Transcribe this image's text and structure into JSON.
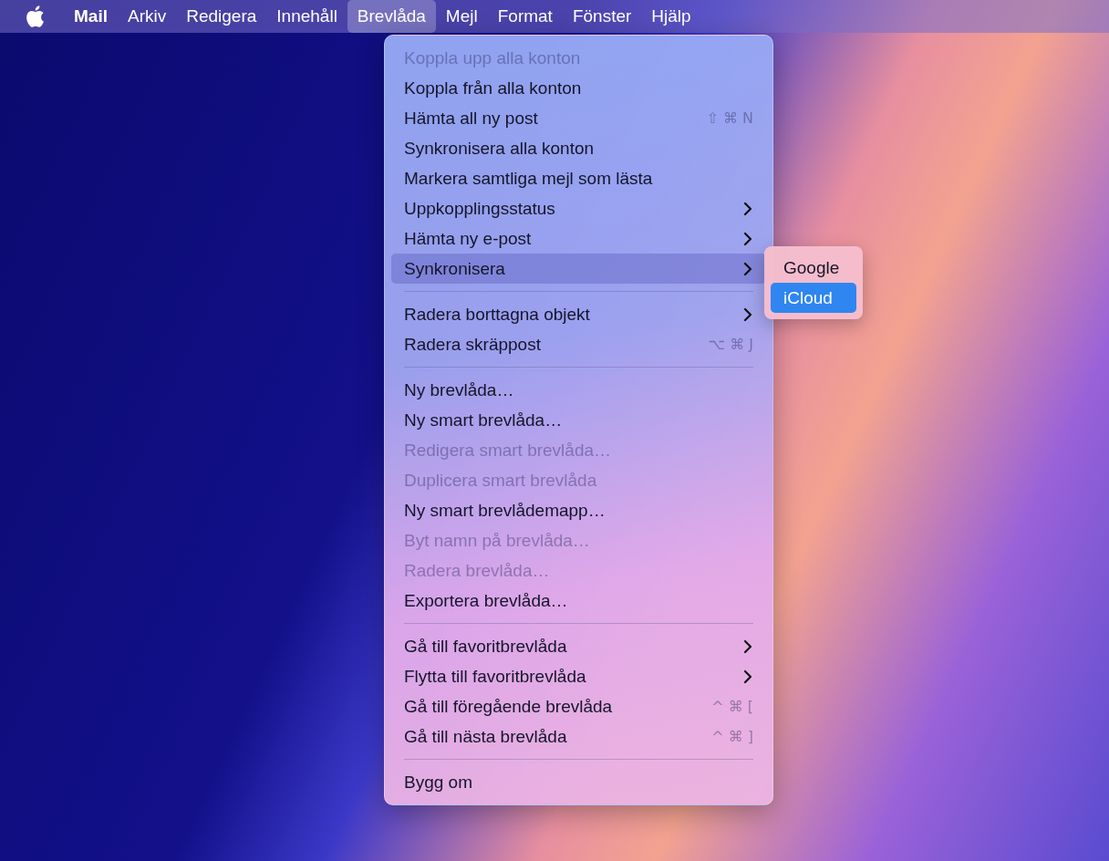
{
  "menu_bar": {
    "items": [
      {
        "label": "Mail",
        "kind": "app",
        "selected": false
      },
      {
        "label": "Arkiv",
        "kind": "menu",
        "selected": false
      },
      {
        "label": "Redigera",
        "kind": "menu",
        "selected": false
      },
      {
        "label": "Innehåll",
        "kind": "menu",
        "selected": false
      },
      {
        "label": "Brevlåda",
        "kind": "menu",
        "selected": true
      },
      {
        "label": "Mejl",
        "kind": "menu",
        "selected": false
      },
      {
        "label": "Format",
        "kind": "menu",
        "selected": false
      },
      {
        "label": "Fönster",
        "kind": "menu",
        "selected": false
      },
      {
        "label": "Hjälp",
        "kind": "menu",
        "selected": false
      }
    ]
  },
  "menu": {
    "items": [
      {
        "kind": "item",
        "label": "Koppla upp alla konton",
        "disabled": true,
        "submenu": false,
        "selected": false
      },
      {
        "kind": "item",
        "label": "Koppla från alla konton",
        "disabled": false,
        "submenu": false,
        "selected": false
      },
      {
        "kind": "item",
        "label": "Hämta all ny post",
        "disabled": false,
        "submenu": false,
        "selected": false,
        "shortcut": "⇧ ⌘ N"
      },
      {
        "kind": "item",
        "label": "Synkronisera alla konton",
        "disabled": false,
        "submenu": false,
        "selected": false
      },
      {
        "kind": "item",
        "label": "Markera samtliga mejl som lästa",
        "disabled": false,
        "submenu": false,
        "selected": false
      },
      {
        "kind": "item",
        "label": "Uppkopplingsstatus",
        "disabled": false,
        "submenu": true,
        "selected": false
      },
      {
        "kind": "item",
        "label": "Hämta ny e-post",
        "disabled": false,
        "submenu": true,
        "selected": false
      },
      {
        "kind": "item",
        "label": "Synkronisera",
        "disabled": false,
        "submenu": true,
        "selected": true,
        "submenu_items": [
          {
            "label": "Google",
            "selected": false
          },
          {
            "label": "iCloud",
            "selected": true
          }
        ]
      },
      {
        "kind": "separator"
      },
      {
        "kind": "item",
        "label": "Radera borttagna objekt",
        "disabled": false,
        "submenu": true,
        "selected": false
      },
      {
        "kind": "item",
        "label": "Radera skräppost",
        "disabled": false,
        "submenu": false,
        "selected": false,
        "shortcut": "⌥ ⌘ J"
      },
      {
        "kind": "separator"
      },
      {
        "kind": "item",
        "label": "Ny brevlåda…",
        "disabled": false,
        "submenu": false,
        "selected": false
      },
      {
        "kind": "item",
        "label": "Ny smart brevlåda…",
        "disabled": false,
        "submenu": false,
        "selected": false
      },
      {
        "kind": "item",
        "label": "Redigera smart brevlåda…",
        "disabled": true,
        "submenu": false,
        "selected": false
      },
      {
        "kind": "item",
        "label": "Duplicera smart brevlåda",
        "disabled": true,
        "submenu": false,
        "selected": false
      },
      {
        "kind": "item",
        "label": "Ny smart brevlådemapp…",
        "disabled": false,
        "submenu": false,
        "selected": false
      },
      {
        "kind": "item",
        "label": "Byt namn på brevlåda…",
        "disabled": true,
        "submenu": false,
        "selected": false
      },
      {
        "kind": "item",
        "label": "Radera brevlåda…",
        "disabled": true,
        "submenu": false,
        "selected": false
      },
      {
        "kind": "item",
        "label": "Exportera brevlåda…",
        "disabled": false,
        "submenu": false,
        "selected": false
      },
      {
        "kind": "separator"
      },
      {
        "kind": "item",
        "label": "Gå till favoritbrevlåda",
        "disabled": false,
        "submenu": true,
        "selected": false
      },
      {
        "kind": "item",
        "label": "Flytta till favoritbrevlåda",
        "disabled": false,
        "submenu": true,
        "selected": false
      },
      {
        "kind": "item",
        "label": "Gå till föregående brevlåda",
        "disabled": false,
        "submenu": false,
        "selected": false,
        "shortcut": "^ ⌘ ["
      },
      {
        "kind": "item",
        "label": "Gå till nästa brevlåda",
        "disabled": false,
        "submenu": false,
        "selected": false,
        "shortcut": "^ ⌘ ]"
      },
      {
        "kind": "separator"
      },
      {
        "kind": "item",
        "label": "Bygg om",
        "disabled": false,
        "submenu": false,
        "selected": false
      }
    ]
  }
}
